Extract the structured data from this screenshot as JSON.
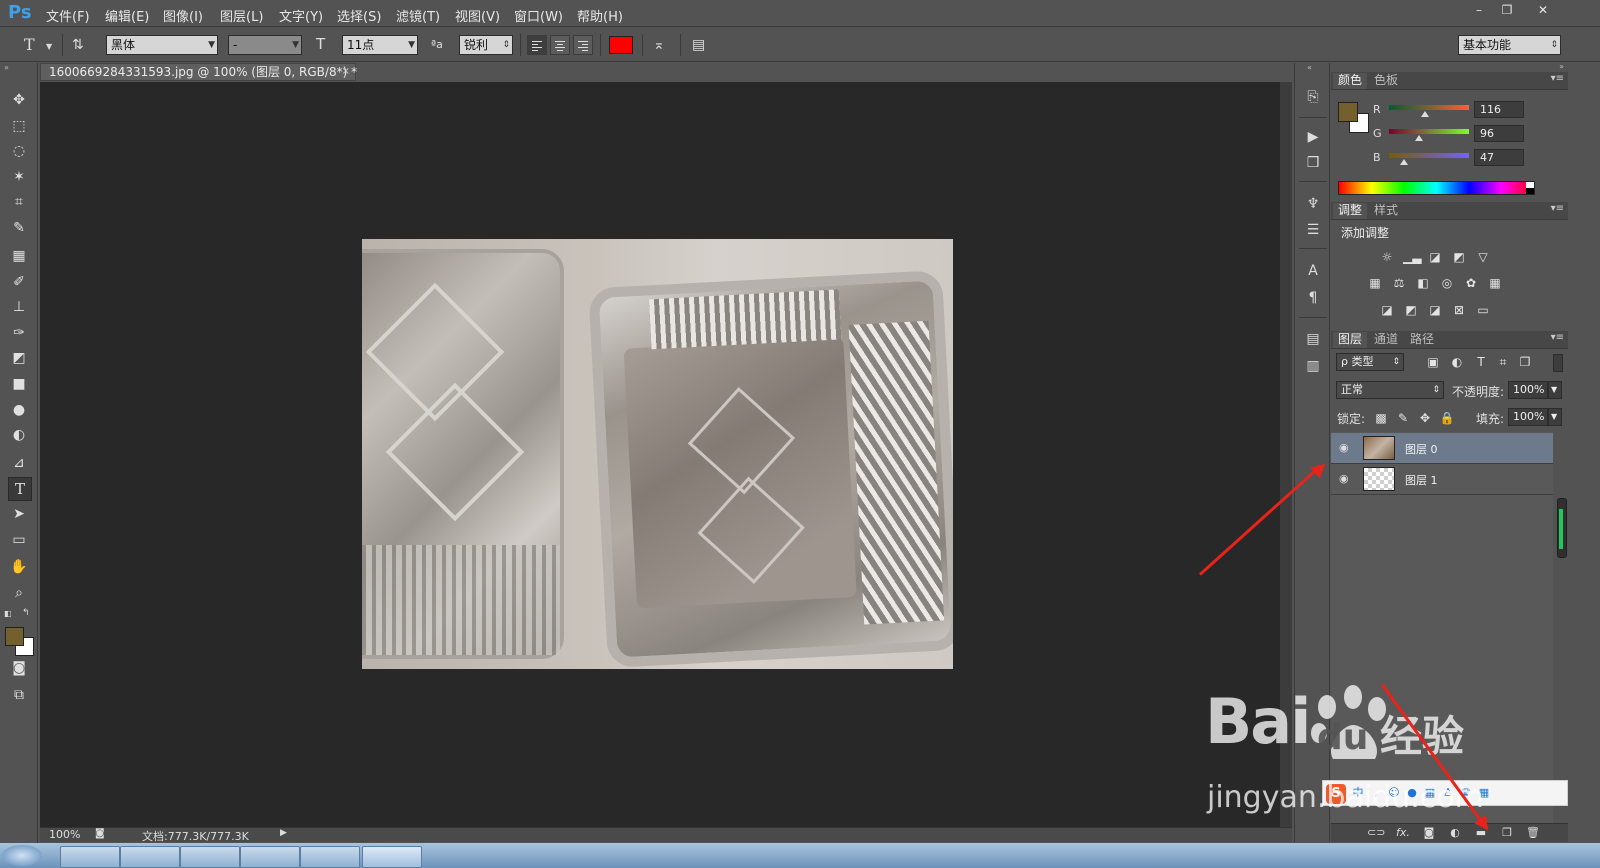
{
  "app": {
    "logo": "Ps",
    "menu": [
      "文件(F)",
      "编辑(E)",
      "图像(I)",
      "图层(L)",
      "文字(Y)",
      "选择(S)",
      "滤镜(T)",
      "视图(V)",
      "窗口(W)",
      "帮助(H)"
    ],
    "window_buttons": [
      "–",
      "❐",
      "✕"
    ]
  },
  "options": {
    "tool_glyph": "T",
    "font_family": "黑体",
    "font_style": "-",
    "font_size": "11点",
    "antialias_prefix": "ªa",
    "antialias": "锐利",
    "text_color": "#ff0000",
    "workspace": "基本功能"
  },
  "document": {
    "tab_title": "1600669284331593.jpg @ 100% (图层 0, RGB/8*) *",
    "close": "×",
    "zoom": "100%",
    "doc_size": "文档:777.3K/777.3K"
  },
  "color_panel": {
    "tabs": [
      "颜色",
      "色板"
    ],
    "foreground": "#74602f",
    "background": "#ffffff",
    "r_label": "R",
    "g_label": "G",
    "b_label": "B",
    "r": 116,
    "g": 96,
    "b": 47
  },
  "adjust_panel": {
    "tabs": [
      "调整",
      "样式"
    ],
    "title": "添加调整"
  },
  "layers_panel": {
    "tabs": [
      "图层",
      "通道",
      "路径"
    ],
    "filter": "ρ 类型",
    "blend_mode": "正常",
    "opacity_label": "不透明度:",
    "opacity": "100%",
    "lock_label": "锁定:",
    "fill_label": "填充:",
    "fill": "100%",
    "layers": [
      {
        "name": "图层 0",
        "selected": true
      },
      {
        "name": "图层 1",
        "selected": false
      }
    ]
  },
  "watermark": {
    "brand": "Bai",
    "brand2": "du",
    "product": "经验",
    "url": "jingyan.baidu.com"
  }
}
